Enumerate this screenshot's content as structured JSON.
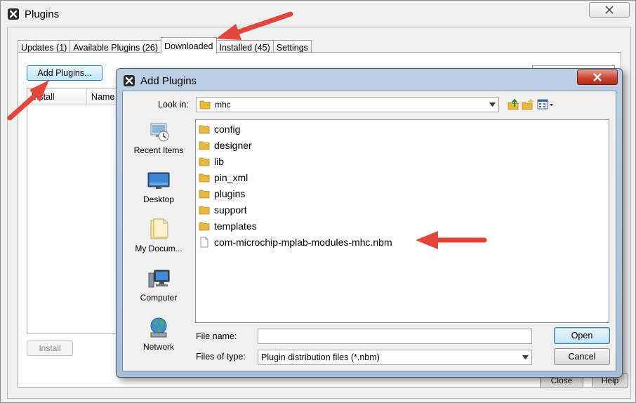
{
  "window": {
    "title": "Plugins"
  },
  "tabs": [
    {
      "label": "Updates (1)"
    },
    {
      "label": "Available Plugins (26)"
    },
    {
      "label": "Downloaded"
    },
    {
      "label": "Installed (45)"
    },
    {
      "label": "Settings"
    }
  ],
  "downloaded_panel": {
    "add_plugins_label": "Add Plugins...",
    "table_columns": [
      "Install",
      "Name"
    ],
    "install_label": "Install"
  },
  "footer": {
    "close_label": "Close",
    "help_label": "Help"
  },
  "dialog": {
    "title": "Add Plugins",
    "look_in_label": "Look in:",
    "look_in_value": "mhc",
    "places": [
      {
        "label": "Recent Items",
        "icon": "recent-items-icon"
      },
      {
        "label": "Desktop",
        "icon": "desktop-icon"
      },
      {
        "label": "My Docum...",
        "icon": "my-documents-icon"
      },
      {
        "label": "Computer",
        "icon": "computer-icon"
      },
      {
        "label": "Network",
        "icon": "network-icon"
      }
    ],
    "files": [
      {
        "name": "config",
        "type": "folder"
      },
      {
        "name": "designer",
        "type": "folder"
      },
      {
        "name": "lib",
        "type": "folder"
      },
      {
        "name": "pin_xml",
        "type": "folder"
      },
      {
        "name": "plugins",
        "type": "folder"
      },
      {
        "name": "support",
        "type": "folder"
      },
      {
        "name": "templates",
        "type": "folder"
      },
      {
        "name": "com-microchip-mplab-modules-mhc.nbm",
        "type": "file"
      }
    ],
    "file_name_label": "File name:",
    "file_name_value": "",
    "files_of_type_label": "Files of type:",
    "files_of_type_value": "Plugin distribution files (*.nbm)",
    "open_label": "Open",
    "cancel_label": "Cancel"
  },
  "colors": {
    "annotation_arrow": "#e2463a",
    "folder": "#e8b93c"
  }
}
